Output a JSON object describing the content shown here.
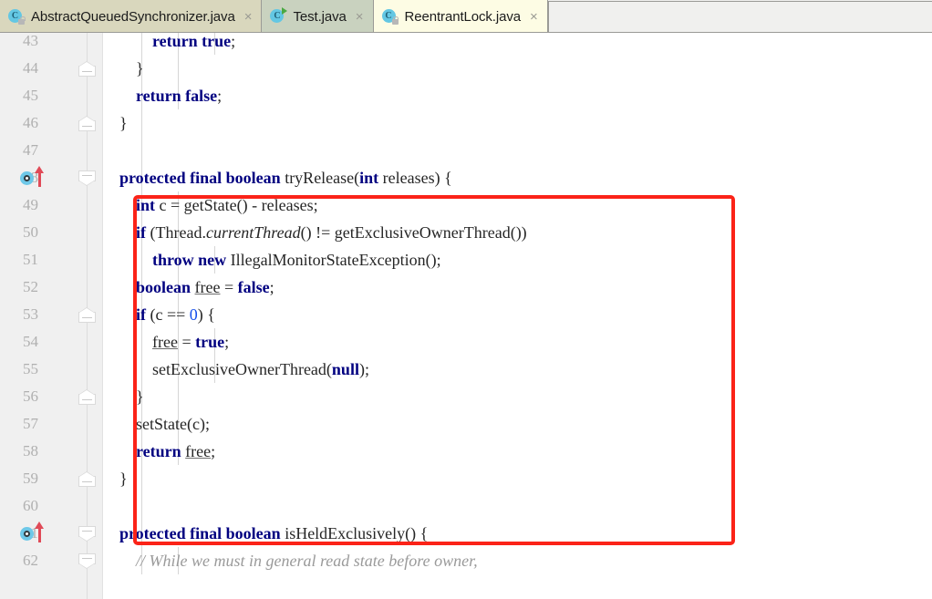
{
  "window": {
    "title": "ReentrantLock.java"
  },
  "colors": {
    "keyword": "#000080",
    "number": "#1750eb",
    "comment": "#9a9a9a",
    "highlight_box": "#fb2318",
    "marker_blue": "#6ec8e8",
    "arrow_red": "#e04a57",
    "tab_active_bg": "#fdfce4",
    "tab_inactive_bg": "#d9d7bd",
    "tab_modified_bg": "#c9d2bf",
    "gutter_bg": "#f0f0f0",
    "editor_bg": "#ffffff"
  },
  "tabbar": {
    "tabs": [
      {
        "label": "AbstractQueuedSynchronizer.java",
        "icon": "java-class-icon",
        "close": "×",
        "active": false,
        "state": "plain"
      },
      {
        "label": "Test.java",
        "icon": "java-class-runnable-icon",
        "close": "×",
        "active": false,
        "state": "runnable"
      },
      {
        "label": "ReentrantLock.java",
        "icon": "java-class-icon",
        "close": "×",
        "active": true,
        "state": "plain"
      }
    ]
  },
  "editor": {
    "first_visible_line": 43,
    "lines": [
      {
        "num": "43",
        "indent_guides": [
          0,
          1,
          2
        ],
        "fold": null,
        "marker": null,
        "tokens": [
          {
            "t": "            ",
            "c": "pln"
          },
          {
            "t": "return",
            "c": "kw"
          },
          {
            "t": " ",
            "c": "pln"
          },
          {
            "t": "true",
            "c": "kw"
          },
          {
            "t": ";",
            "c": "pln"
          }
        ]
      },
      {
        "num": "44",
        "indent_guides": [
          0,
          1
        ],
        "fold": "up",
        "marker": null,
        "tokens": [
          {
            "t": "        }",
            "c": "pln"
          }
        ]
      },
      {
        "num": "45",
        "indent_guides": [
          0,
          1
        ],
        "fold": null,
        "marker": null,
        "tokens": [
          {
            "t": "        ",
            "c": "pln"
          },
          {
            "t": "return",
            "c": "kw"
          },
          {
            "t": " ",
            "c": "pln"
          },
          {
            "t": "false",
            "c": "kw"
          },
          {
            "t": ";",
            "c": "pln"
          }
        ]
      },
      {
        "num": "46",
        "indent_guides": [
          0
        ],
        "fold": "up",
        "marker": null,
        "tokens": [
          {
            "t": "    }",
            "c": "pln"
          }
        ]
      },
      {
        "num": "47",
        "indent_guides": [
          0
        ],
        "fold": null,
        "marker": null,
        "tokens": []
      },
      {
        "num": "48",
        "indent_guides": [
          0
        ],
        "fold": "down",
        "marker": "implements-arrow",
        "tokens": [
          {
            "t": "    ",
            "c": "pln"
          },
          {
            "t": "protected",
            "c": "kw"
          },
          {
            "t": " ",
            "c": "pln"
          },
          {
            "t": "final",
            "c": "kw"
          },
          {
            "t": " ",
            "c": "pln"
          },
          {
            "t": "boolean",
            "c": "kw"
          },
          {
            "t": " tryRelease(",
            "c": "pln"
          },
          {
            "t": "int",
            "c": "kw"
          },
          {
            "t": " releases) {",
            "c": "pln"
          }
        ]
      },
      {
        "num": "49",
        "indent_guides": [
          0,
          1
        ],
        "fold": null,
        "marker": null,
        "tokens": [
          {
            "t": "        ",
            "c": "pln"
          },
          {
            "t": "int",
            "c": "kw"
          },
          {
            "t": " c = getState() - releases;",
            "c": "pln"
          }
        ]
      },
      {
        "num": "50",
        "indent_guides": [
          0,
          1
        ],
        "fold": null,
        "marker": null,
        "tokens": [
          {
            "t": "        ",
            "c": "pln"
          },
          {
            "t": "if",
            "c": "kw"
          },
          {
            "t": " (Thread.",
            "c": "pln"
          },
          {
            "t": "currentThread",
            "c": "stat"
          },
          {
            "t": "() != getExclusiveOwnerThread())",
            "c": "pln"
          }
        ]
      },
      {
        "num": "51",
        "indent_guides": [
          0,
          1,
          2
        ],
        "fold": null,
        "marker": null,
        "tokens": [
          {
            "t": "            ",
            "c": "pln"
          },
          {
            "t": "throw",
            "c": "kw"
          },
          {
            "t": " ",
            "c": "pln"
          },
          {
            "t": "new",
            "c": "kw"
          },
          {
            "t": " IllegalMonitorStateException();",
            "c": "pln"
          }
        ]
      },
      {
        "num": "52",
        "indent_guides": [
          0,
          1
        ],
        "fold": null,
        "marker": null,
        "tokens": [
          {
            "t": "        ",
            "c": "pln"
          },
          {
            "t": "boolean",
            "c": "kw"
          },
          {
            "t": " ",
            "c": "pln"
          },
          {
            "t": "free",
            "c": "lvar"
          },
          {
            "t": " = ",
            "c": "pln"
          },
          {
            "t": "false",
            "c": "kw"
          },
          {
            "t": ";",
            "c": "pln"
          }
        ]
      },
      {
        "num": "53",
        "indent_guides": [
          0,
          1
        ],
        "fold": "up",
        "marker": null,
        "tokens": [
          {
            "t": "        ",
            "c": "pln"
          },
          {
            "t": "if",
            "c": "kw"
          },
          {
            "t": " (c == ",
            "c": "pln"
          },
          {
            "t": "0",
            "c": "num"
          },
          {
            "t": ") {",
            "c": "pln"
          }
        ]
      },
      {
        "num": "54",
        "indent_guides": [
          0,
          1,
          2
        ],
        "fold": null,
        "marker": null,
        "tokens": [
          {
            "t": "            ",
            "c": "pln"
          },
          {
            "t": "free",
            "c": "lvar"
          },
          {
            "t": " = ",
            "c": "pln"
          },
          {
            "t": "true",
            "c": "kw"
          },
          {
            "t": ";",
            "c": "pln"
          }
        ]
      },
      {
        "num": "55",
        "indent_guides": [
          0,
          1,
          2
        ],
        "fold": null,
        "marker": null,
        "tokens": [
          {
            "t": "            setExclusiveOwnerThread(",
            "c": "pln"
          },
          {
            "t": "null",
            "c": "kw"
          },
          {
            "t": ");",
            "c": "pln"
          }
        ]
      },
      {
        "num": "56",
        "indent_guides": [
          0,
          1
        ],
        "fold": "up",
        "marker": null,
        "tokens": [
          {
            "t": "        }",
            "c": "pln"
          }
        ]
      },
      {
        "num": "57",
        "indent_guides": [
          0,
          1
        ],
        "fold": null,
        "marker": null,
        "tokens": [
          {
            "t": "        setState(c);",
            "c": "pln"
          }
        ]
      },
      {
        "num": "58",
        "indent_guides": [
          0,
          1
        ],
        "fold": null,
        "marker": null,
        "tokens": [
          {
            "t": "        ",
            "c": "pln"
          },
          {
            "t": "return",
            "c": "kw"
          },
          {
            "t": " ",
            "c": "pln"
          },
          {
            "t": "free",
            "c": "lvar"
          },
          {
            "t": ";",
            "c": "pln"
          }
        ]
      },
      {
        "num": "59",
        "indent_guides": [
          0
        ],
        "fold": "up",
        "marker": null,
        "tokens": [
          {
            "t": "    }",
            "c": "pln"
          }
        ]
      },
      {
        "num": "60",
        "indent_guides": [
          0
        ],
        "fold": null,
        "marker": null,
        "tokens": []
      },
      {
        "num": "61",
        "indent_guides": [
          0
        ],
        "fold": "down",
        "marker": "implements-arrow",
        "tokens": [
          {
            "t": "    ",
            "c": "pln"
          },
          {
            "t": "protected",
            "c": "kw"
          },
          {
            "t": " ",
            "c": "pln"
          },
          {
            "t": "final",
            "c": "kw"
          },
          {
            "t": " ",
            "c": "pln"
          },
          {
            "t": "boolean",
            "c": "kw"
          },
          {
            "t": " isHeldExclusively() {",
            "c": "pln"
          }
        ]
      },
      {
        "num": "62",
        "indent_guides": [
          0,
          1
        ],
        "fold": "down",
        "marker": null,
        "tokens": [
          {
            "t": "        ",
            "c": "pln"
          },
          {
            "t": "// While we must in general read state before owner,",
            "c": "cmt"
          }
        ]
      }
    ]
  },
  "annotation": {
    "highlight_box": {
      "name": "tryRelease-highlight-rectangle",
      "covers_lines": "48-59",
      "color": "#fb2318"
    }
  }
}
